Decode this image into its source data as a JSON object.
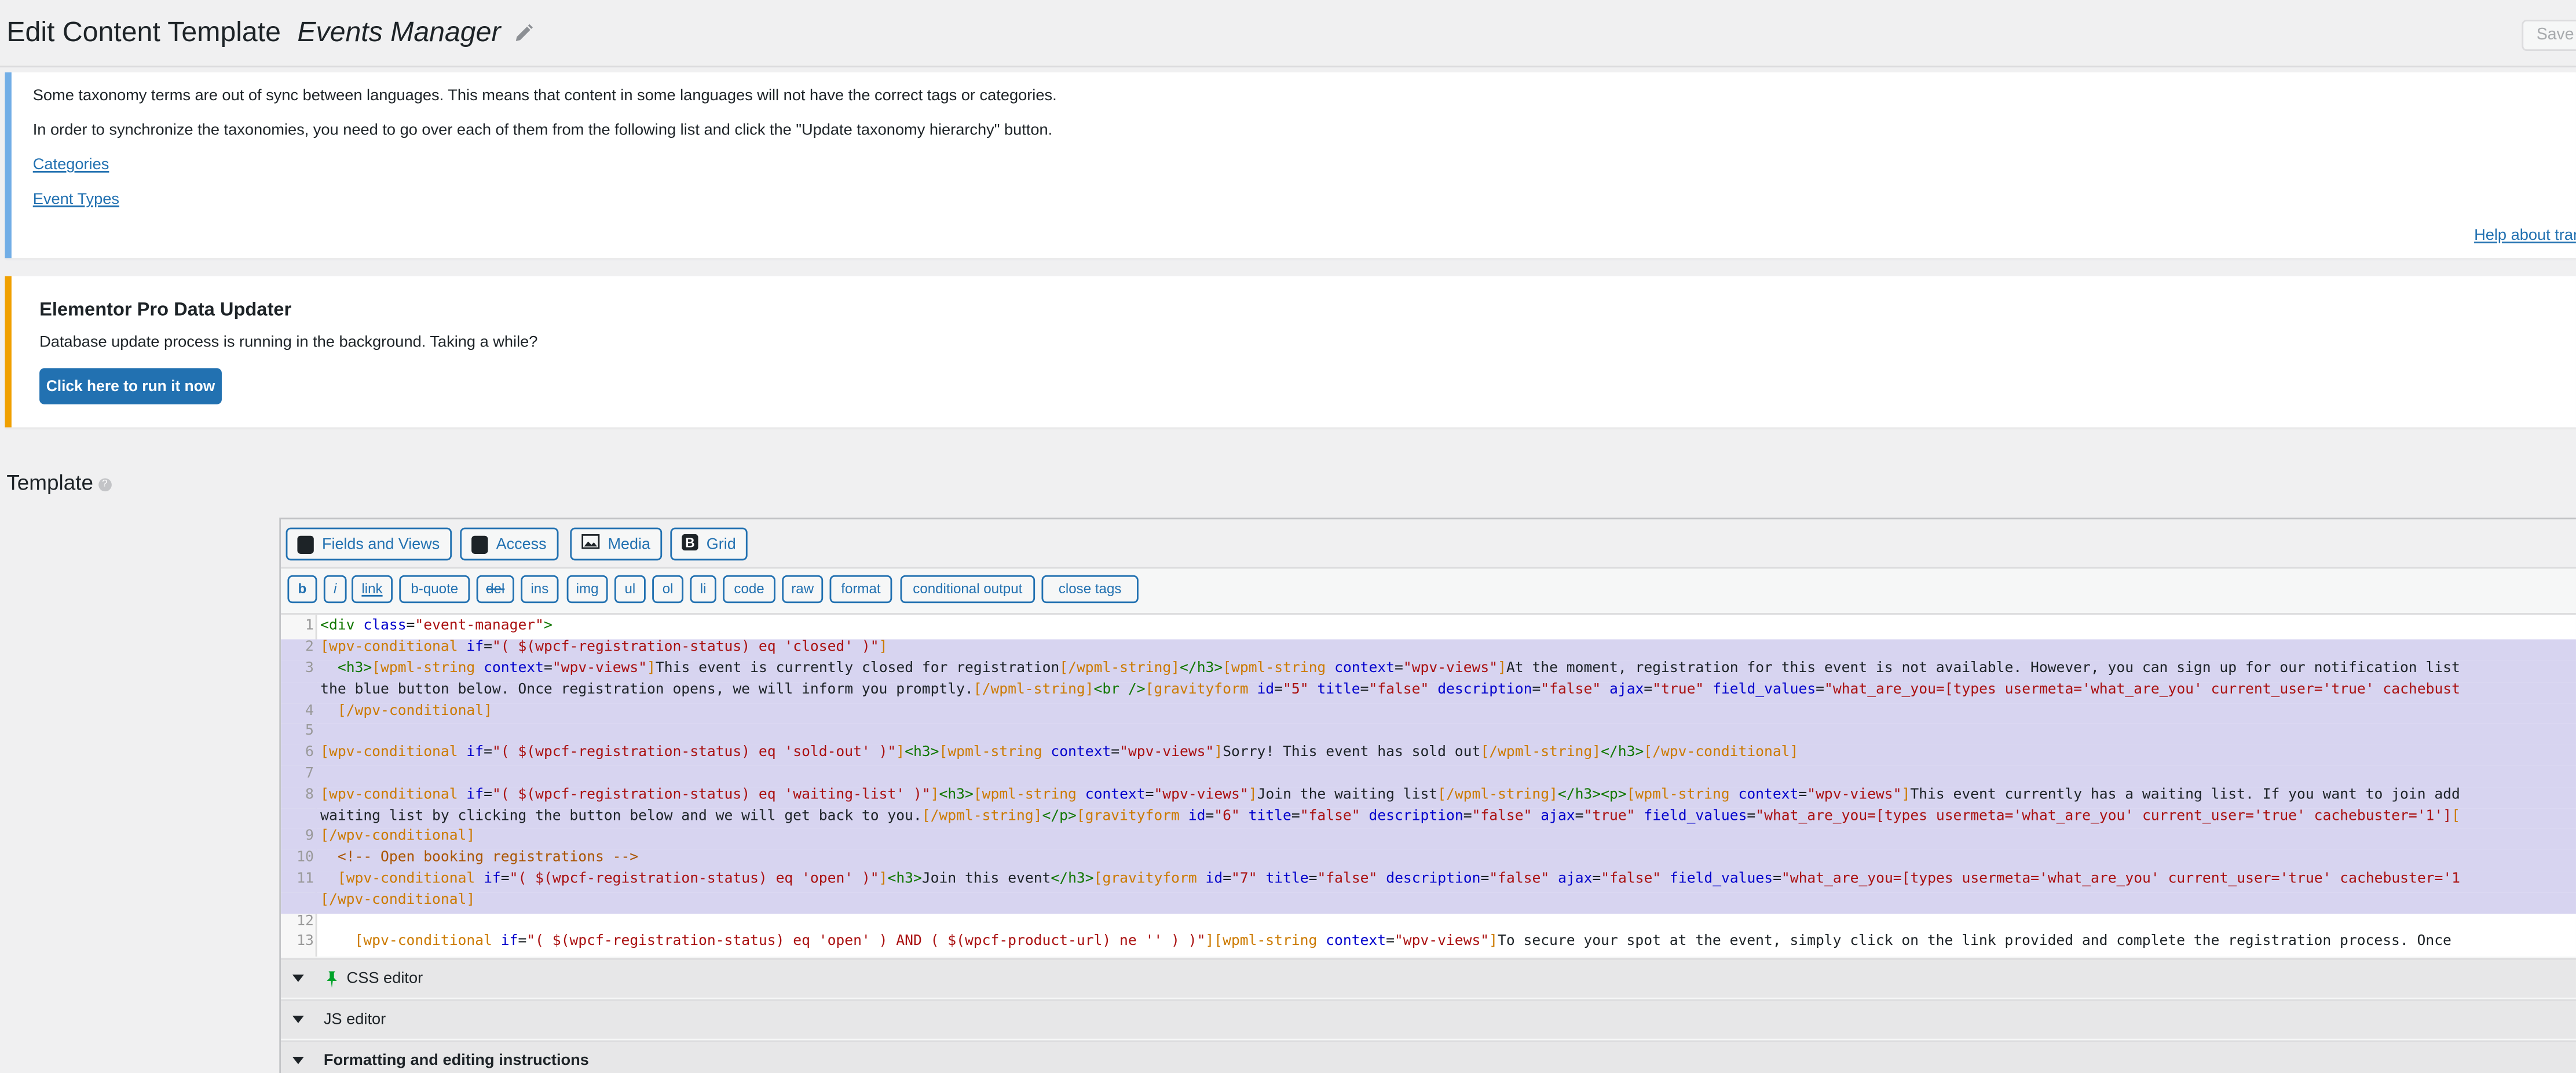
{
  "header": {
    "title": "Edit Content Template",
    "template_name": "Events Manager",
    "save_label": "Save t"
  },
  "wpml_notice": {
    "line1": "Some taxonomy terms are out of sync between languages. This means that content in some languages will not have the correct tags or categories.",
    "line2": "In order to synchronize the taxonomies, you need to go over each of them from the following list and click the \"Update taxonomy hierarchy\" button.",
    "link1": "Categories",
    "link2": "Event Types",
    "help_link": "Help about tran"
  },
  "elementor_notice": {
    "title": "Elementor Pro Data Updater",
    "text": "Database update process is running in the background. Taking a while?",
    "button": "Click here to run it now"
  },
  "section": {
    "title": "Template"
  },
  "toolbar": {
    "tabs": [
      "Fields and Views",
      "Access",
      "Media",
      "Grid"
    ],
    "quicktags": [
      "b",
      "i",
      "link",
      "b-quote",
      "del",
      "ins",
      "img",
      "ul",
      "ol",
      "li",
      "code",
      "raw",
      "format",
      "conditional output",
      "close tags"
    ]
  },
  "code": {
    "line_numbers": [
      "1",
      "2",
      "3",
      "",
      "4",
      "5",
      "6",
      "7",
      "8",
      "",
      "9",
      "10",
      "11",
      "",
      "12",
      "13"
    ]
  },
  "panels": {
    "css": "CSS editor",
    "js": "JS editor",
    "formatting": "Formatting and editing instructions"
  }
}
